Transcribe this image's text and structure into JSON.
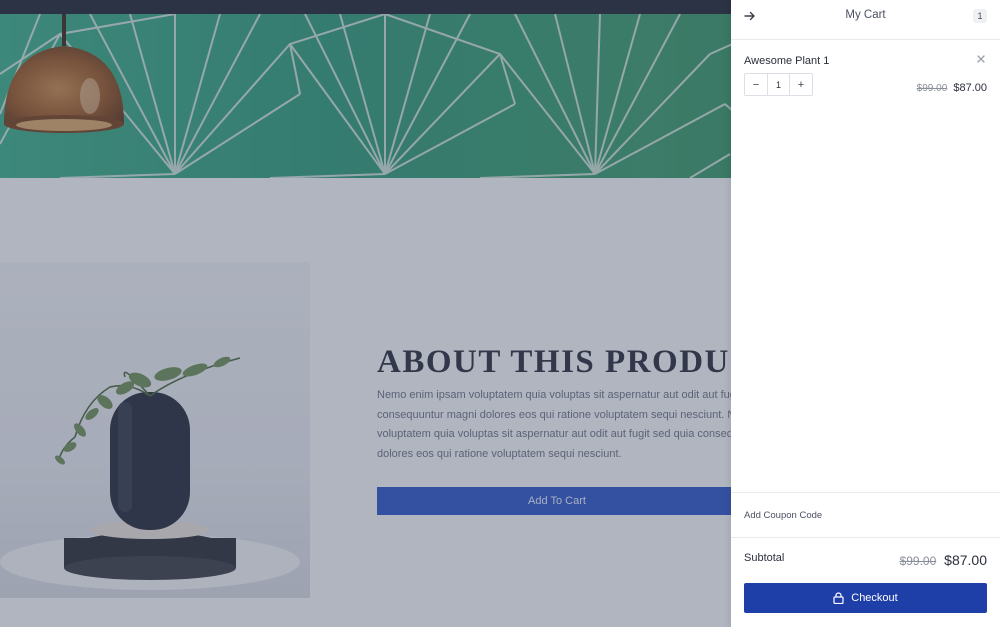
{
  "product_section": {
    "heading": "ABOUT THIS PRODUCT",
    "description_lines": [
      "Nemo enim ipsam voluptatem quia voluptas sit aspernatur aut odit aut fugit sed",
      "consequuntur magni dolores eos qui ratione voluptatem sequi nesciunt. Nemo e",
      "voluptatem quia voluptas sit aspernatur aut odit aut fugit sed quia consequuntur",
      "dolores eos qui ratione voluptatem sequi nesciunt."
    ],
    "add_to_cart_label": "Add To Cart"
  },
  "cart": {
    "title": "My Cart",
    "count": "1",
    "items": [
      {
        "name": "Awesome Plant 1",
        "quantity": "1",
        "original_price": "$99.00",
        "sale_price": "$87.00"
      }
    ],
    "coupon_label": "Add Coupon Code",
    "subtotal_label": "Subtotal",
    "subtotal_original": "$99.00",
    "subtotal_sale": "$87.00",
    "checkout_label": "Checkout",
    "qty_minus": "−",
    "qty_plus": "+"
  },
  "icons": {
    "back": "arrow-right-icon",
    "remove": "close-icon",
    "checkout": "lock-icon"
  },
  "colors": {
    "checkout_button": "#1f3fa8",
    "add_to_cart_button": "#2e56c7",
    "hero_tile": "#3bb08a"
  }
}
